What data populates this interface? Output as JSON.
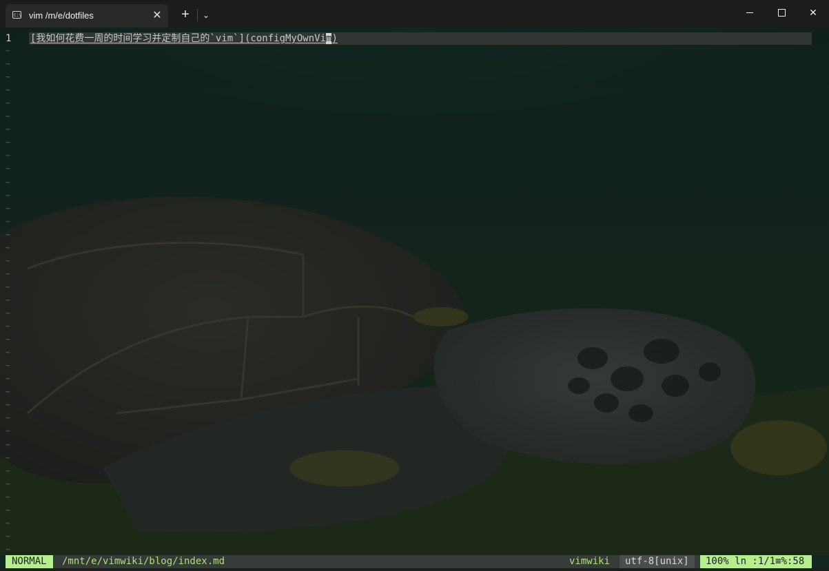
{
  "window": {
    "tab_title": "vim /m/e/dotfiles",
    "tab_icon_glyph": "C:\\",
    "new_tab_glyph": "+",
    "dropdown_glyph": "⌄",
    "close_tab_glyph": "✕",
    "close_window_glyph": "✕"
  },
  "editor": {
    "line_number": "1",
    "line_text_before_cursor": "[我如何花费一周的时间学习并定制自己的`vim`](configMyOwnVi",
    "cursor_char": "m",
    "line_text_after_cursor": ")",
    "empty_line_marker": "~",
    "empty_line_count": 39
  },
  "statusline": {
    "mode": "NORMAL",
    "file_path": "/mnt/e/vimwiki/blog/index.md",
    "filetype": "vimwiki",
    "encoding": "utf-8[unix]",
    "position": "100%  ln :1/1≡%:58"
  },
  "colors": {
    "mode_bg": "#b5ee8c",
    "path_fg": "#a6e37a",
    "statusline_bg": "#373b38"
  }
}
